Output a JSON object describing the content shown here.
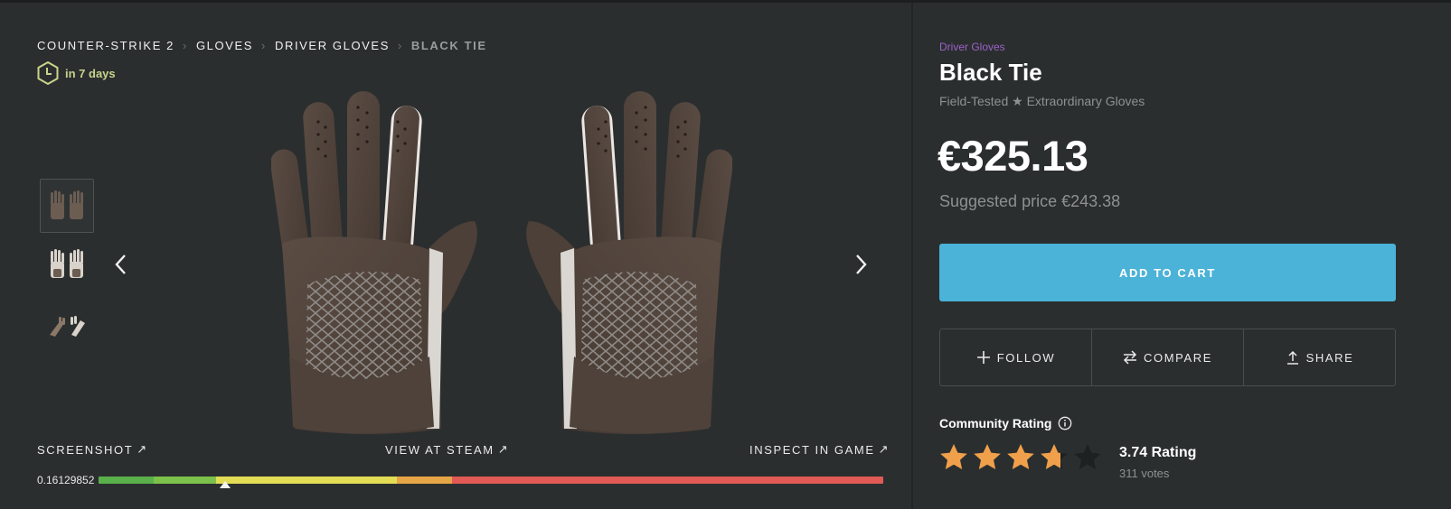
{
  "breadcrumb": {
    "items": [
      "COUNTER-STRIKE 2",
      "GLOVES",
      "DRIVER GLOVES"
    ],
    "current": "BLACK TIE"
  },
  "trade_hold": {
    "text": "in 7 days",
    "icon": "clock-hexagon-icon"
  },
  "gallery": {
    "thumbnails": [
      "gloves-back-view",
      "gloves-palm-view",
      "gloves-side-view"
    ],
    "active_index": 0
  },
  "links": {
    "screenshot": "SCREENSHOT",
    "steam": "VIEW AT STEAM",
    "inspect": "INSPECT IN GAME"
  },
  "float": {
    "value": "0.16129852",
    "fraction": 0.161,
    "segments": [
      {
        "color": "#5ab04a",
        "share": 0.07
      },
      {
        "color": "#7cc24a",
        "share": 0.08
      },
      {
        "color": "#e2dd55",
        "share": 0.23
      },
      {
        "color": "#e6a547",
        "share": 0.07
      },
      {
        "color": "#e15a55",
        "share": 0.55
      }
    ]
  },
  "item": {
    "category": "Driver Gloves",
    "name": "Black Tie",
    "subtitle": "Field-Tested ★ Extraordinary Gloves",
    "price": "€325.13",
    "suggested": "Suggested price €243.38"
  },
  "buttons": {
    "add_to_cart": "ADD TO CART",
    "follow": "FOLLOW",
    "compare": "COMPARE",
    "share": "SHARE"
  },
  "rating": {
    "label": "Community Rating",
    "value": "3.74 Rating",
    "votes": "311 votes",
    "score": 3.74,
    "max": 5
  },
  "colors": {
    "accent": "#4bb2d8",
    "category": "#9a63c9",
    "trade_hold": "#c8d48a",
    "star": "#f0a04b"
  }
}
